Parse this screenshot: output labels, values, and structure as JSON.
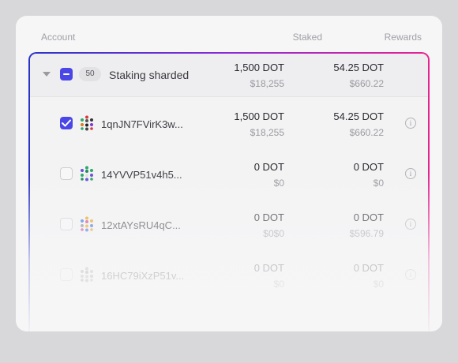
{
  "header": {
    "account": "Account",
    "staked": "Staked",
    "rewards": "Rewards"
  },
  "group": {
    "count": "50",
    "title": "Staking sharded",
    "staked": "1,500 DOT",
    "staked_usd": "$18,255",
    "rewards": "54.25 DOT",
    "rewards_usd": "$660.22"
  },
  "accounts": [
    {
      "address": "1qnJN7FVirK3w...",
      "checked": true,
      "staked": "1,500 DOT",
      "staked_usd": "$18,255",
      "rewards": "54.25 DOT",
      "rewards_usd": "$660.22"
    },
    {
      "address": "14YVVP51v4h5...",
      "checked": false,
      "staked": "0 DOT",
      "staked_usd": "$0",
      "rewards": "0 DOT",
      "rewards_usd": "$0"
    },
    {
      "address": "12xtAYsRU4qC...",
      "checked": false,
      "staked": "0 DOT",
      "staked_usd": "$0$0",
      "rewards": "0 DOT",
      "rewards_usd": "$596.79"
    },
    {
      "address": "16HC79iXzP51v...",
      "checked": false,
      "staked": "0 DOT",
      "staked_usd": "$0",
      "rewards": "0 DOT",
      "rewards_usd": "$0"
    }
  ],
  "colors": {
    "accent": "#4b47e6",
    "gradient_start": "#2a35c8",
    "gradient_end": "#e8238f"
  },
  "icons": {
    "expand": "chevron-down-icon",
    "info": "info-icon",
    "identicon": "identicon-icon"
  }
}
